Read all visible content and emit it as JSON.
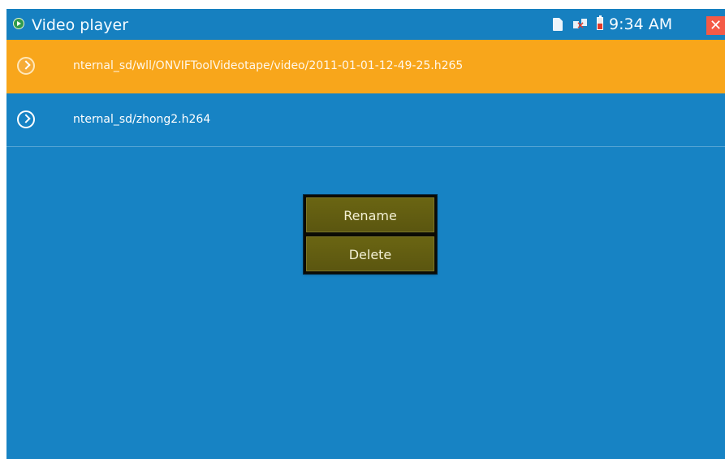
{
  "app": {
    "title": "Video player",
    "icon": "play-circle-icon"
  },
  "status": {
    "time": "9:34 AM",
    "icons": [
      "sd-card-icon",
      "network-error-icon",
      "battery-icon",
      "close-icon"
    ],
    "close_symbol": "✕"
  },
  "files": [
    {
      "label": "nternal_sd/wll/ONVIFToolVideotape/video/2011-01-01-12-49-25.h265",
      "icon": "chevron-circle-icon",
      "selected": true
    },
    {
      "label": "nternal_sd/zhong2.h264",
      "icon": "chevron-circle-icon",
      "selected": false
    }
  ],
  "context_menu": {
    "items": [
      {
        "label": "Rename"
      },
      {
        "label": "Delete"
      }
    ]
  },
  "colors": {
    "background": "#1783c4",
    "selected_row": "#f8a61b",
    "menu_button": "#5f5a11",
    "close_button": "#f45a46"
  }
}
